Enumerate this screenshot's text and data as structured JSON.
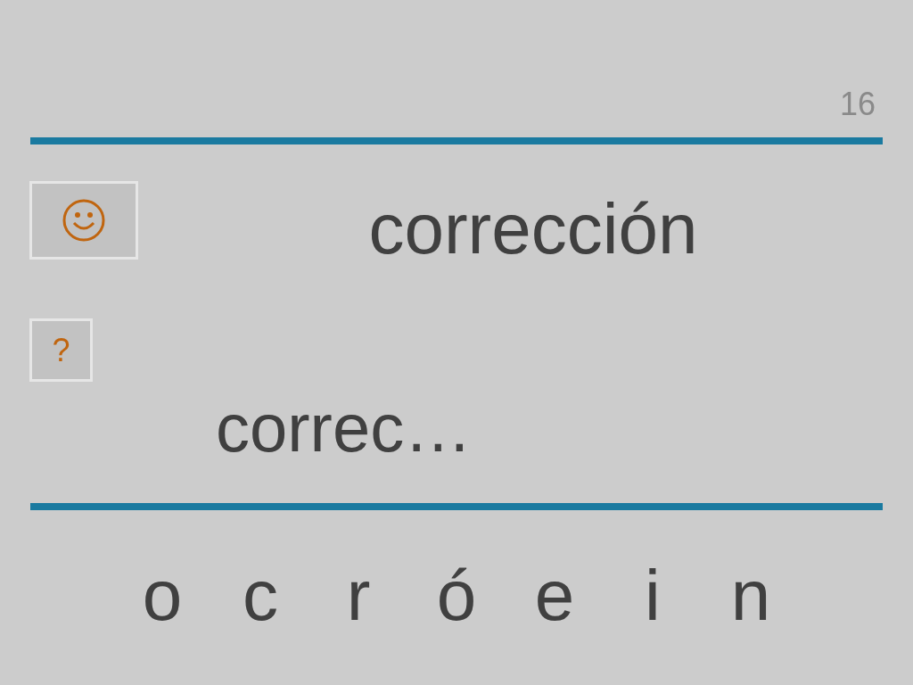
{
  "page_number": "16",
  "word": "corrección",
  "hint_button": {
    "label": "?"
  },
  "answer": "correc…",
  "letters": [
    "o",
    "c",
    "r",
    "ó",
    "e",
    "i",
    "n"
  ]
}
